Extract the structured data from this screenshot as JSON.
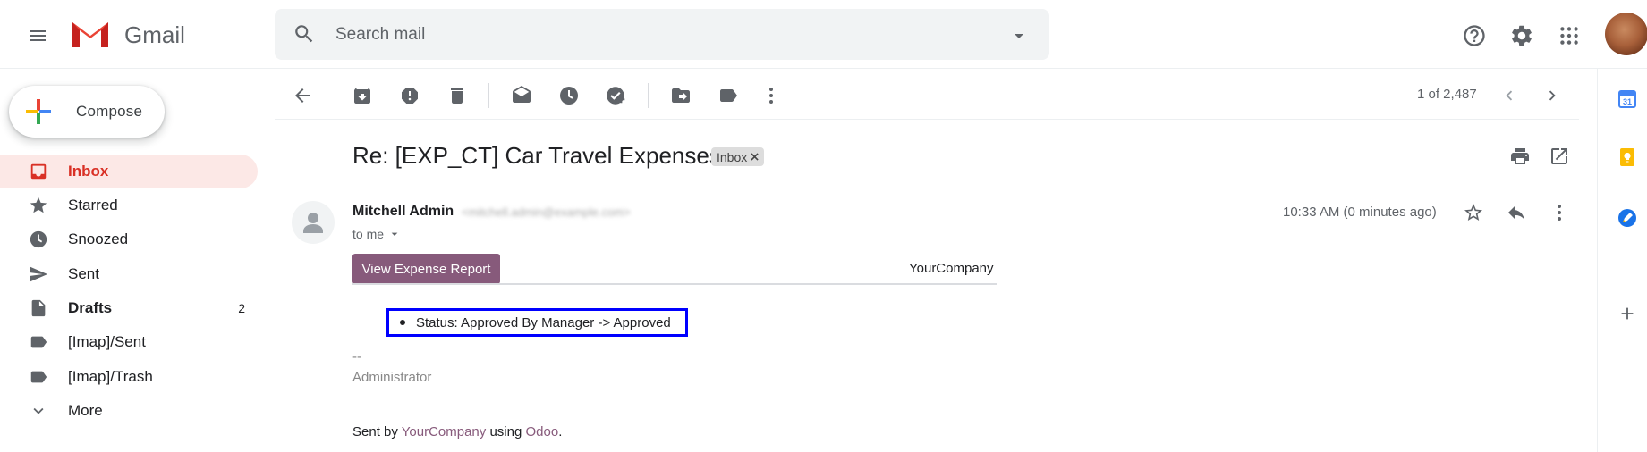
{
  "app": {
    "name": "Gmail"
  },
  "search": {
    "placeholder": "Search mail"
  },
  "compose": {
    "label": "Compose"
  },
  "sidebar": {
    "items": [
      {
        "label": "Inbox",
        "icon": "inbox-icon",
        "active": true
      },
      {
        "label": "Starred",
        "icon": "star-icon"
      },
      {
        "label": "Snoozed",
        "icon": "clock-icon"
      },
      {
        "label": "Sent",
        "icon": "send-icon"
      },
      {
        "label": "Drafts",
        "icon": "draft-icon",
        "count": "2"
      },
      {
        "label": "[Imap]/Sent",
        "icon": "label-icon"
      },
      {
        "label": "[Imap]/Trash",
        "icon": "label-icon"
      },
      {
        "label": "More",
        "icon": "chevron-down-icon"
      }
    ]
  },
  "toolbar": {
    "page_count": "1 of 2,487"
  },
  "email": {
    "subject": "Re: [EXP_CT] Car Travel Expenses",
    "label_chip": "Inbox",
    "sender_name": "Mitchell Admin",
    "sender_email": "<mitchell.admin@example.com>",
    "to": "to me",
    "time": "10:33 AM (0 minutes ago)",
    "view_button": "View Expense Report",
    "company": "YourCompany",
    "status": "Status: Approved By Manager -> Approved",
    "signature_dash": "--",
    "signature_name": "Administrator",
    "footer": {
      "prefix": "Sent by ",
      "company": "YourCompany",
      "middle": " using ",
      "product": "Odoo",
      "suffix": "."
    }
  },
  "colors": {
    "accent_red": "#d93025",
    "odoo_purple": "#875a7b",
    "highlight_box": "#0000ff"
  }
}
